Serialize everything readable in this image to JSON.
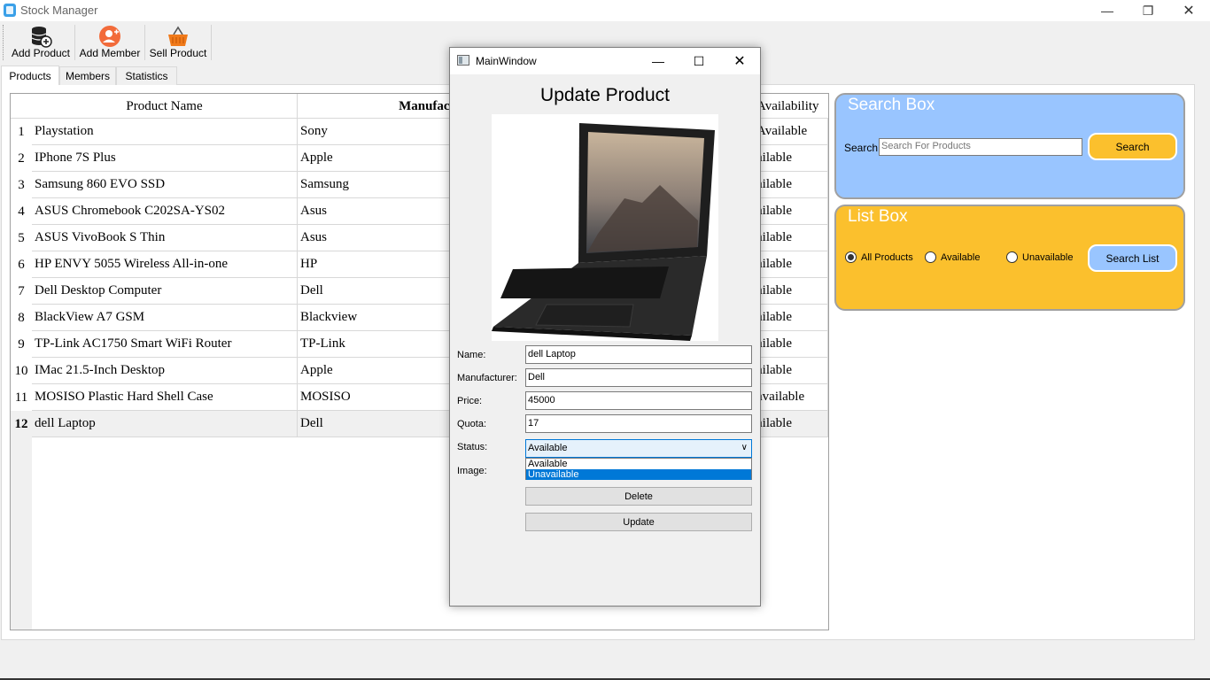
{
  "window": {
    "title": "Stock Manager"
  },
  "toolbar": [
    {
      "label": "Add Product",
      "icon": "database-add-icon"
    },
    {
      "label": "Add Member",
      "icon": "user-add-icon"
    },
    {
      "label": "Sell Product",
      "icon": "basket-icon"
    }
  ],
  "tabs": [
    "Products",
    "Members",
    "Statistics"
  ],
  "active_tab": "Products",
  "table": {
    "columns": [
      "Product Name",
      "Manufactu",
      "Availability"
    ],
    "rows": [
      {
        "num": "1",
        "name": "Playstation",
        "manufacturer": "Sony",
        "availability": "Available"
      },
      {
        "num": "2",
        "name": "IPhone 7S Plus",
        "manufacturer": "Apple",
        "availability": "ailable"
      },
      {
        "num": "3",
        "name": "Samsung 860 EVO SSD",
        "manufacturer": "Samsung",
        "availability": "ailable"
      },
      {
        "num": "4",
        "name": "ASUS Chromebook C202SA-YS02",
        "manufacturer": "Asus",
        "availability": "ailable"
      },
      {
        "num": "5",
        "name": "ASUS VivoBook S Thin",
        "manufacturer": "Asus",
        "availability": "ailable"
      },
      {
        "num": "6",
        "name": "HP ENVY 5055 Wireless All-in-one",
        "manufacturer": "HP",
        "availability": "ailable"
      },
      {
        "num": "7",
        "name": "Dell Desktop Computer",
        "manufacturer": "Dell",
        "availability": "ailable"
      },
      {
        "num": "8",
        "name": "BlackView A7 GSM",
        "manufacturer": "Blackview",
        "availability": "ailable"
      },
      {
        "num": "9",
        "name": "TP-Link AC1750 Smart WiFi Router",
        "manufacturer": "TP-Link",
        "availability": "ailable"
      },
      {
        "num": "10",
        "name": "IMac 21.5-Inch Desktop",
        "manufacturer": "Apple",
        "availability": "ailable"
      },
      {
        "num": "11",
        "name": "MOSISO Plastic Hard Shell Case",
        "manufacturer": "MOSISO",
        "availability": "available"
      },
      {
        "num": "12",
        "name": "dell Laptop",
        "manufacturer": "Dell",
        "availability": "ailable"
      }
    ]
  },
  "search_box": {
    "title": "Search Box",
    "label": "Search",
    "placeholder": "Search For Products",
    "button": "Search",
    "color": "#99c5ff"
  },
  "list_box": {
    "title": "List Box",
    "options": [
      "All Products",
      "Available",
      "Unavailable"
    ],
    "selected": "All Products",
    "button": "Search List",
    "color": "#fbc02d"
  },
  "dialog": {
    "title": "MainWindow",
    "heading": "Update Product",
    "fields": {
      "name_label": "Name:",
      "name_value": "dell Laptop",
      "manufacturer_label": "Manufacturer:",
      "manufacturer_value": "Dell",
      "price_label": "Price:",
      "price_value": "45000",
      "quota_label": "Quota:",
      "quota_value": "17",
      "status_label": "Status:",
      "status_value": "Available",
      "image_label": "Image:"
    },
    "status_options": [
      "Available",
      "Unavailable"
    ],
    "highlighted_option": "Unavailable",
    "delete_button": "Delete",
    "update_button": "Update"
  }
}
